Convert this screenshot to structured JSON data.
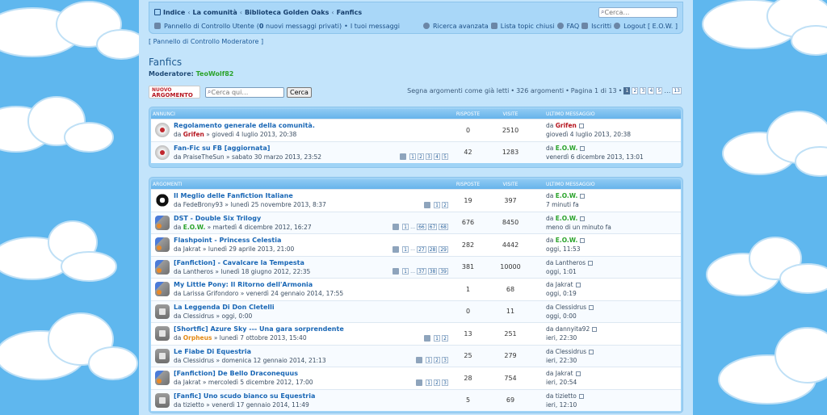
{
  "nav": {
    "home_icon": "home-icon",
    "breadcrumbs": [
      "Indice",
      "La comunità",
      "Biblioteca Golden Oaks",
      "Fanfics"
    ],
    "search_placeholder": "Cerca…",
    "control_panel": "Pannello di Controllo Utente",
    "new_messages_pre": "(",
    "new_messages_count": "0",
    "new_messages_post": " nuovi messaggi privati)",
    "sep": "•",
    "my_messages": "I tuoi messaggi",
    "advanced_search": "Ricerca avanzata",
    "closed_topics": "Lista topic chiusi",
    "faq": "FAQ",
    "subscribed": "Iscritti",
    "logout": "Logout [ E.O.W. ]"
  },
  "mod_panel": "[ Pannello di Controllo Moderatore ]",
  "forum": {
    "title": "Fanfics",
    "moderator_label": "Moderatore:",
    "moderator_name": "TeoWolf82"
  },
  "actions": {
    "new_topic_small": "NUOVO",
    "new_topic_big": "ARGOMENTO",
    "search_placeholder": "Cerca qui…",
    "search_button": "Cerca",
    "mark_read": "Segna argomenti come già letti",
    "topic_count": "326 argomenti",
    "page_info": "Pagina 1 di 13",
    "pages": [
      "1",
      "2",
      "3",
      "4",
      "5",
      "…",
      "13"
    ]
  },
  "announce_header": {
    "title": "ANNUNCI",
    "replies": "RISPOSTE",
    "views": "VISITE",
    "last": "ULTIMO MESSAGGIO"
  },
  "announcements": [
    {
      "icon": "ann",
      "title": "Regolamento generale della comunità.",
      "by": "da",
      "author": "Grifen",
      "author_style": "red",
      "date": "giovedì 4 luglio 2013, 20:38",
      "pages": [],
      "replies": "0",
      "views": "2510",
      "last_by": "Grifen",
      "last_style": "red",
      "last_date": "giovedì 4 luglio 2013, 20:38"
    },
    {
      "icon": "ann",
      "title": "Fan-Fic su FB [aggiornata]",
      "by": "da",
      "author": "PraiseTheSun",
      "author_style": "",
      "date": "sabato 30 marzo 2013, 23:52",
      "pages": [
        "1",
        "2",
        "3",
        "4",
        "5"
      ],
      "replies": "42",
      "views": "1283",
      "last_by": "E.O.W.",
      "last_style": "green",
      "last_date": "venerdì 6 dicembre 2013, 13:01"
    }
  ],
  "topics_header": {
    "title": "ARGOMENTI",
    "replies": "RISPOSTE",
    "views": "VISITE",
    "last": "ULTIMO MESSAGGIO"
  },
  "topics": [
    {
      "icon": "pony",
      "title": "Il Meglio delle Fanfiction Italiane",
      "by": "da",
      "author": "FedeBrony93",
      "author_style": "",
      "date": "lunedì 25 novembre 2013, 8:37",
      "pages": [
        "1",
        "2"
      ],
      "replies": "19",
      "views": "397",
      "last_by": "E.O.W.",
      "last_style": "green",
      "last_date": "7 minuti fa"
    },
    {
      "icon": "mix",
      "title": "DST - Double Six Trilogy",
      "by": "da",
      "author": "E.O.W.",
      "author_style": "green",
      "date": "martedì 4 dicembre 2012, 16:27",
      "pages": [
        "1",
        "…",
        "66",
        "67",
        "68"
      ],
      "replies": "676",
      "views": "8450",
      "last_by": "E.O.W.",
      "last_style": "green",
      "last_date": "meno di un minuto fa"
    },
    {
      "icon": "mix",
      "title": "Flashpoint - Princess Celestia",
      "by": "da",
      "author": "Jakrat",
      "author_style": "",
      "date": "lunedì 29 aprile 2013, 21:00",
      "pages": [
        "1",
        "…",
        "27",
        "28",
        "29"
      ],
      "replies": "282",
      "views": "4442",
      "last_by": "E.O.W.",
      "last_style": "green",
      "last_date": "oggi, 11:53"
    },
    {
      "icon": "mix",
      "title": "[Fanfiction] - Cavalcare la Tempesta",
      "by": "da",
      "author": "Lantheros",
      "author_style": "",
      "date": "lunedì 18 giugno 2012, 22:35",
      "pages": [
        "1",
        "…",
        "37",
        "38",
        "39"
      ],
      "replies": "381",
      "views": "10000",
      "last_by": "Lantheros",
      "last_style": "",
      "last_date": "oggi, 1:01"
    },
    {
      "icon": "mix",
      "title": "My Little Pony: Il Ritorno dell'Armonia",
      "by": "da",
      "author": "Larissa Grifondoro",
      "author_style": "",
      "date": "venerdì 24 gennaio 2014, 17:55",
      "pages": [],
      "replies": "1",
      "views": "68",
      "last_by": "Jakrat",
      "last_style": "",
      "last_date": "oggi, 0:19"
    },
    {
      "icon": "std",
      "title": "La Leggenda Di Don Cletelli",
      "by": "da",
      "author": "Clessidrus",
      "author_style": "",
      "date": "oggi, 0:00",
      "pages": [],
      "replies": "0",
      "views": "11",
      "last_by": "Clessidrus",
      "last_style": "",
      "last_date": "oggi, 0:00"
    },
    {
      "icon": "std",
      "title": "[Shortfic] Azure Sky --- Una gara sorprendente",
      "by": "da",
      "author": "Orpheus",
      "author_style": "orange",
      "date": "lunedì 7 ottobre 2013, 15:40",
      "pages": [
        "1",
        "2"
      ],
      "replies": "13",
      "views": "251",
      "last_by": "dannyita92",
      "last_style": "",
      "last_date": "ieri, 22:30"
    },
    {
      "icon": "std",
      "title": "Le Fiabe Di Equestria",
      "by": "da",
      "author": "Clessidrus",
      "author_style": "",
      "date": "domenica 12 gennaio 2014, 21:13",
      "pages": [
        "1",
        "2",
        "3"
      ],
      "replies": "25",
      "views": "279",
      "last_by": "Clessidrus",
      "last_style": "",
      "last_date": "ieri, 22:30"
    },
    {
      "icon": "mix",
      "title": "[Fanfiction] De Bello Draconequus",
      "by": "da",
      "author": "Jakrat",
      "author_style": "",
      "date": "mercoledì 5 dicembre 2012, 17:00",
      "pages": [
        "1",
        "2",
        "3"
      ],
      "replies": "28",
      "views": "754",
      "last_by": "Jakrat",
      "last_style": "",
      "last_date": "ieri, 20:54"
    },
    {
      "icon": "std",
      "title": "[Fanfic] Uno scudo bianco su Equestria",
      "by": "da",
      "author": "tizietto",
      "author_style": "",
      "date": "venerdì 17 gennaio 2014, 11:49",
      "pages": [],
      "replies": "5",
      "views": "69",
      "last_by": "tizietto",
      "last_style": "",
      "last_date": "ieri, 12:10"
    }
  ]
}
